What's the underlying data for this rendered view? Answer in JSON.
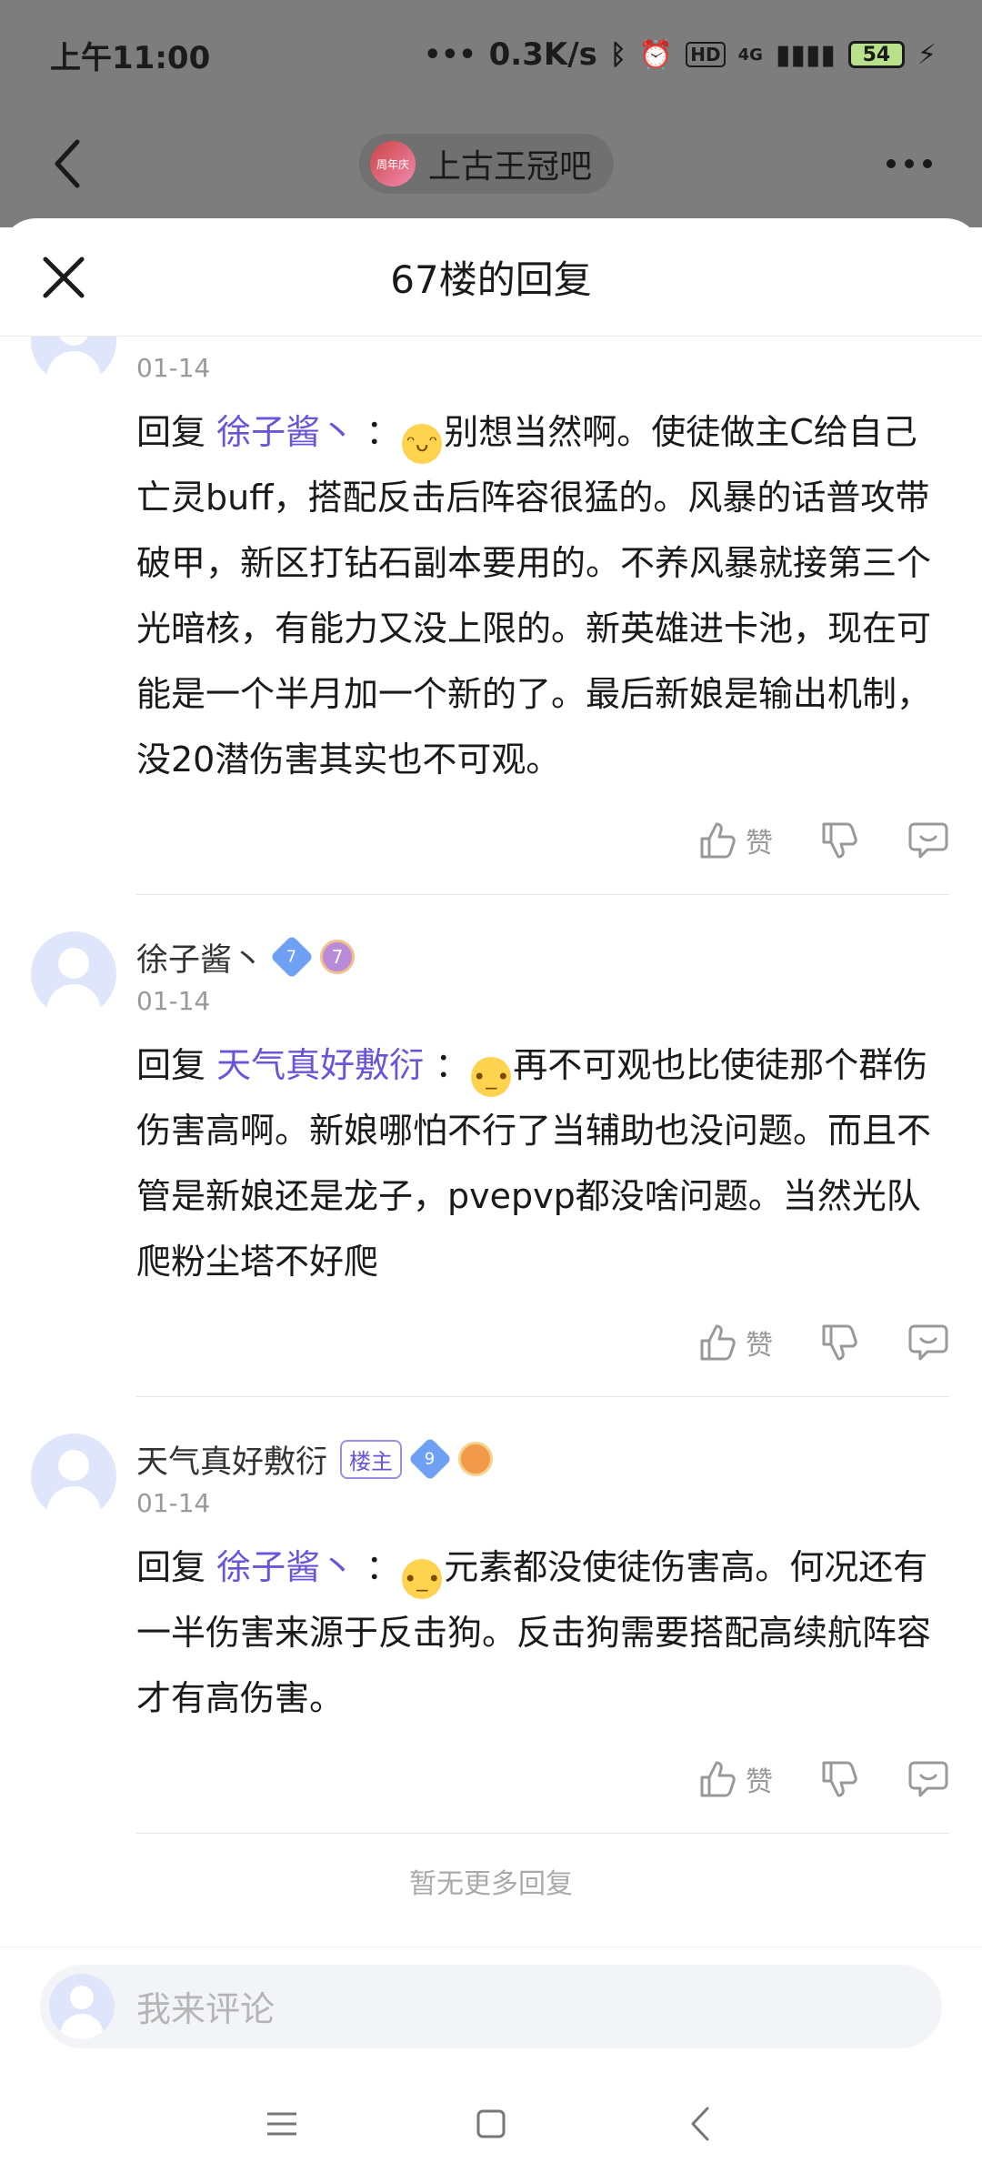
{
  "status": {
    "time": "上午11:00",
    "network_speed": "0.3K/s",
    "hd_label": "HD",
    "signal_label": "4G",
    "battery": "54"
  },
  "nav": {
    "forum_name": "上古王冠吧",
    "forum_avatar_text": "周年庆"
  },
  "sheet": {
    "title": "67楼的回复"
  },
  "comments": [
    {
      "date": "01-14",
      "reply_word": "回复",
      "mention": "徐子酱丶",
      "separator": "：",
      "text": "别想当然啊。使徒做主C给自己亡灵buff，搭配反击后阵容很猛的。风暴的话普攻带破甲，新区打钻石副本要用的。不养风暴就接第三个光暗核，有能力又没上限的。新英雄进卡池，现在可能是一个半月加一个新的了。最后新娘是输出机制，没20潜伤害其实也不可观。",
      "like_label": "赞"
    },
    {
      "name": "徐子酱丶",
      "level": "7",
      "medal": "7",
      "date": "01-14",
      "reply_word": "回复",
      "mention": "天气真好敷衍",
      "separator": "：",
      "text": "再不可观也比使徒那个群伤伤害高啊。新娘哪怕不行了当辅助也没问题。而且不管是新娘还是龙子，pvepvp都没啥问题。当然光队爬粉尘塔不好爬",
      "like_label": "赞"
    },
    {
      "name": "天气真好敷衍",
      "host_badge": "楼主",
      "level": "9",
      "date": "01-14",
      "reply_word": "回复",
      "mention": "徐子酱丶",
      "separator": "：",
      "text": "元素都没使徒伤害高。何况还有一半伤害来源于反击狗。反击狗需要搭配高续航阵容才有高伤害。",
      "like_label": "赞"
    }
  ],
  "no_more": "暂无更多回复",
  "input": {
    "placeholder": "我来评论"
  },
  "colors": {
    "mention": "#6a54d8",
    "dim_overlay": "#7d7d7d"
  }
}
